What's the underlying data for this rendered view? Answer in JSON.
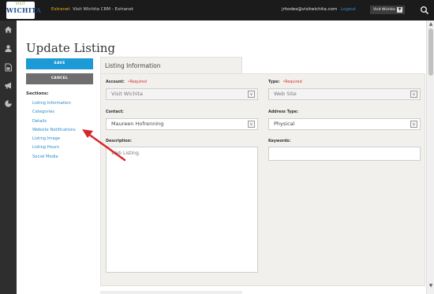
{
  "topbar": {
    "logo_small": "VISIT",
    "logo_main": "WICHITA",
    "nav_extranet": "Extranet",
    "nav_crm": "Visit Wichita CRM - Extranet",
    "user_email": "jrhodes@visitwichita.com",
    "logout": "Logout",
    "visit_button": "Visit Wichita"
  },
  "page": {
    "title": "Update Listing",
    "save_label": "SAVE",
    "cancel_label": "CANCEL",
    "sections_label": "Sections:",
    "sections": [
      "Listing Information",
      "Categories",
      "Details",
      "Website Notifications",
      "Listing Image",
      "Listing Hours",
      "Social Media"
    ]
  },
  "panel": {
    "tab_label": "Listing Information",
    "account_label": "Account:",
    "account_required": "•Required",
    "account_value": "Visit Wichita",
    "type_label": "Type:",
    "type_required": "•Required",
    "type_value": "Web Site",
    "contact_label": "Contact:",
    "contact_value": "Maureen Hofrenning",
    "address_type_label": "Address Type:",
    "address_type_value": "Physical",
    "description_label": "Description:",
    "description_value": "Web Listing.",
    "keywords_label": "Keywords:",
    "keywords_value": ""
  },
  "icons": {
    "rail": [
      "home-icon",
      "user-icon",
      "document-icon",
      "megaphone-icon",
      "pie-chart-icon"
    ],
    "accent_color": "#1c9ad6",
    "arrow_color": "#d8242a"
  }
}
